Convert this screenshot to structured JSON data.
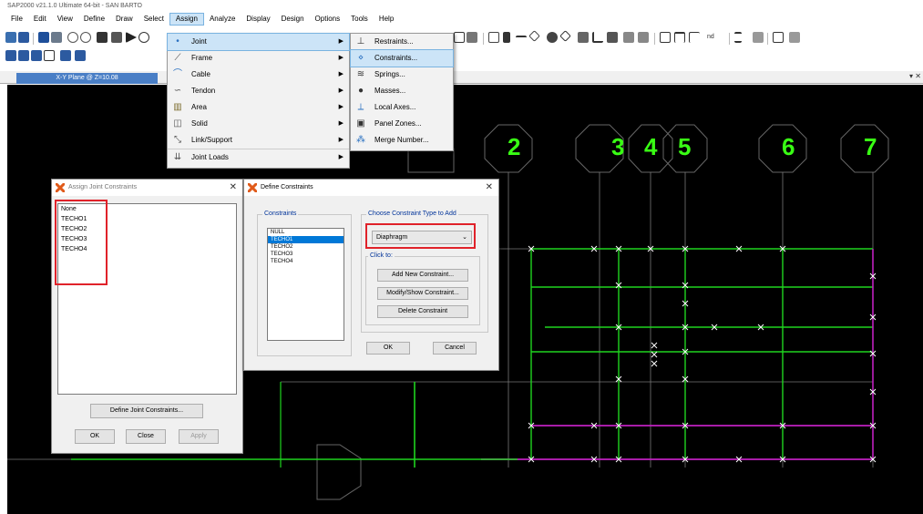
{
  "window": {
    "title": "SAP2000 v21.1.0 Ultimate 64-bit - SAN BARTO"
  },
  "menubar": [
    "File",
    "Edit",
    "View",
    "Define",
    "Draw",
    "Select",
    "Assign",
    "Analyze",
    "Display",
    "Design",
    "Options",
    "Tools",
    "Help"
  ],
  "toolbar": {
    "more_text": "nd"
  },
  "view_tab": {
    "label": "X-Y Plane @ Z=10.08"
  },
  "assign_menu": {
    "items": [
      {
        "label": "Joint",
        "icon": "joint-icon",
        "submenu": true
      },
      {
        "label": "Frame",
        "icon": "frame-icon",
        "submenu": true
      },
      {
        "label": "Cable",
        "icon": "cable-icon",
        "submenu": true
      },
      {
        "label": "Tendon",
        "icon": "tendon-icon",
        "submenu": true
      },
      {
        "label": "Area",
        "icon": "area-icon",
        "submenu": true
      },
      {
        "label": "Solid",
        "icon": "solid-icon",
        "submenu": true
      },
      {
        "label": "Link/Support",
        "icon": "link-icon",
        "submenu": true
      },
      {
        "label": "Joint Loads",
        "icon": "joint-loads-icon",
        "submenu": true
      }
    ]
  },
  "joint_submenu": {
    "items": [
      "Restraints...",
      "Constraints...",
      "Springs...",
      "Masses...",
      "Local Axes...",
      "Panel Zones...",
      "Merge Number..."
    ]
  },
  "grid_labels": [
    "2",
    "3",
    "4",
    "5",
    "6",
    "7"
  ],
  "assign_dialog": {
    "title": "Assign Joint Constraints",
    "items": [
      "None",
      "TECHO1",
      "TECHO2",
      "TECHO3",
      "TECHO4"
    ],
    "define_button": "Define Joint Constraints...",
    "ok": "OK",
    "close": "Close",
    "apply": "Apply"
  },
  "define_dialog": {
    "title": "Define Constraints",
    "constraints_label": "Constraints",
    "constraints": [
      "NULL",
      "TECHO1",
      "TECHO2",
      "TECHO3",
      "TECHO4"
    ],
    "selected": "TECHO1",
    "type_label": "Choose Constraint Type to Add",
    "type_value": "Diaphragm",
    "click_to": "Click to:",
    "add": "Add New Constraint...",
    "modify": "Modify/Show Constraint...",
    "delete": "Delete Constraint",
    "ok": "OK",
    "cancel": "Cancel"
  },
  "colors": {
    "grid_label": "#39ff14",
    "highlight_box": "#e0222a",
    "selection": "#0078d7",
    "green_frame": "#1fd41f",
    "magenta_frame": "#c020c0"
  }
}
